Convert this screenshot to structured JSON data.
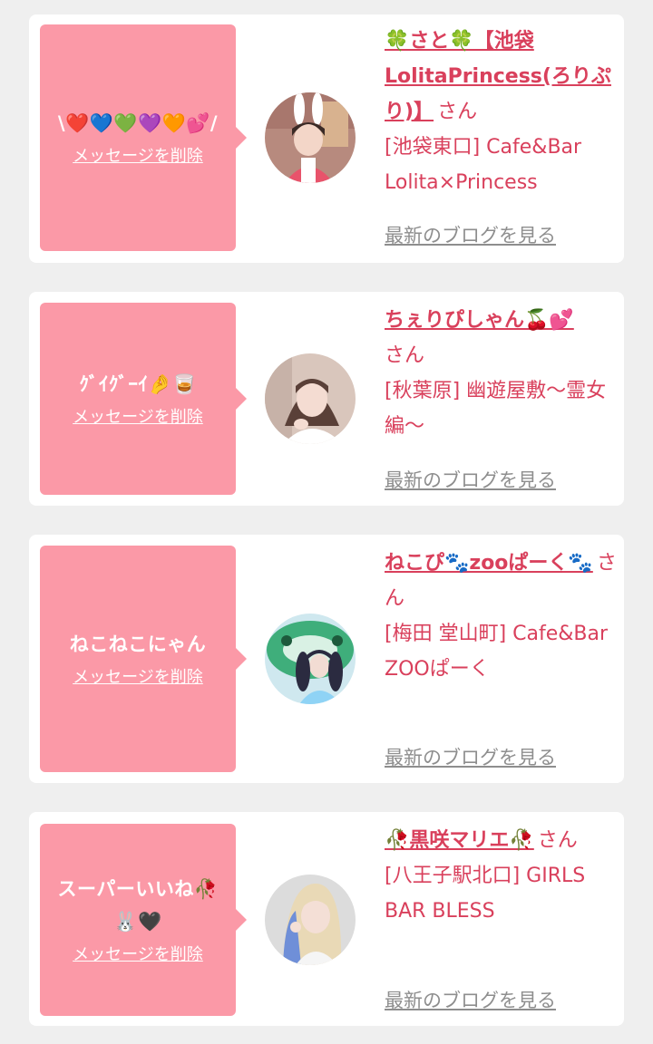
{
  "colors": {
    "page_background": "#efefef",
    "card_background": "#ffffff",
    "bubble_pink": "#fb99a7",
    "name_red": "#d9405c",
    "link_gray": "#8e8e8e"
  },
  "messages": [
    {
      "text": "\\❤️💙💚💜🧡💕/",
      "delete_label": "メッセージを削除",
      "avatar_icon": "girl-bunny-ears-avatar",
      "cast_name": "🍀さと🍀【池袋LolitaPrincess(ろりぷり)】",
      "honorific": "さん",
      "shop": "[池袋東口] Cafe&Bar Lolita×Princess",
      "blog_label": "最新のブログを見る"
    },
    {
      "text": "ｸﾞｲｸﾞｰｲ🤌🥃",
      "delete_label": "メッセージを削除",
      "avatar_icon": "girl-selfie-avatar",
      "cast_name": "ちぇりぴしゃん🍒💕",
      "honorific": "さん",
      "shop": "[秋葉原] 幽遊屋敷〜霊女編〜",
      "blog_label": "最新のブログを見る"
    },
    {
      "text": "ねこねこにゃん",
      "delete_label": "メッセージを削除",
      "avatar_icon": "girl-twintails-avatar",
      "cast_name": "ねこぴ🐾zooぱーく🐾",
      "honorific": "さん",
      "shop": "[梅田 堂山町] Cafe&Bar ZOOぱーく",
      "blog_label": "最新のブログを見る"
    },
    {
      "text": "スーパーいいね🥀🐰🖤",
      "delete_label": "メッセージを削除",
      "avatar_icon": "girl-blonde-avatar",
      "cast_name": "🥀黒咲マリエ🥀",
      "honorific": "さん",
      "shop": "[八王子駅北口] GIRLS BAR BLESS",
      "blog_label": "最新のブログを見る"
    }
  ]
}
